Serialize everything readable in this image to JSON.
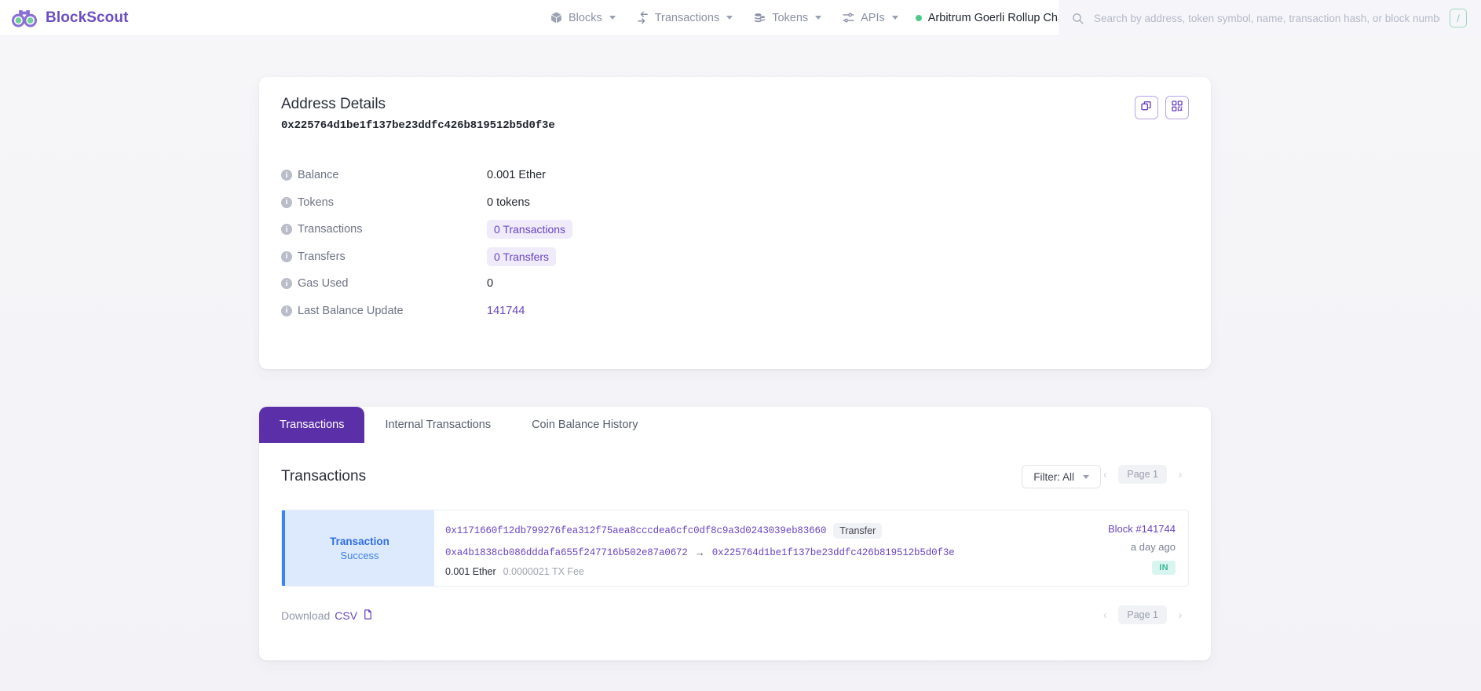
{
  "header": {
    "brand": "BlockScout",
    "nav": [
      {
        "label": "Blocks",
        "icon": "cube-icon"
      },
      {
        "label": "Transactions",
        "icon": "transaction-arrow-icon"
      },
      {
        "label": "Tokens",
        "icon": "coins-stack-icon"
      },
      {
        "label": "APIs",
        "icon": "sliders-icon"
      }
    ],
    "chain": "Arbitrum Goerli Rollup Chain",
    "theme_icon": "moon-icon",
    "search": {
      "placeholder": "Search by address, token symbol, name, transaction hash, or block number",
      "value": "",
      "shortcut": "/"
    }
  },
  "address_card": {
    "title": "Address Details",
    "hash": "0x225764d1be1f137be23ddfc426b819512b5d0f3e",
    "actions": [
      {
        "name": "copy-address-button",
        "icon": "copy-icon"
      },
      {
        "name": "qr-code-button",
        "icon": "qr-code-icon"
      }
    ],
    "rows": [
      {
        "label": "Balance",
        "value": "0.001 Ether",
        "kind": "text"
      },
      {
        "label": "Tokens",
        "value": "0 tokens",
        "kind": "text"
      },
      {
        "label": "Transactions",
        "value": "0 Transactions",
        "kind": "pill"
      },
      {
        "label": "Transfers",
        "value": "0 Transfers",
        "kind": "pill"
      },
      {
        "label": "Gas Used",
        "value": "0",
        "kind": "text"
      },
      {
        "label": "Last Balance Update",
        "value": "141744",
        "kind": "link"
      }
    ]
  },
  "tx_card": {
    "tabs": [
      {
        "label": "Transactions",
        "active": true
      },
      {
        "label": "Internal Transactions",
        "active": false
      },
      {
        "label": "Coin Balance History",
        "active": false
      }
    ],
    "section_title": "Transactions",
    "filter_label": "Filter: All",
    "pagination": {
      "prev": "‹",
      "page": "Page 1",
      "next": "›"
    },
    "transaction": {
      "type": "Transaction",
      "status": "Success",
      "hash": "0x1171660f12db799276fea312f75aea8cccdea6cfc0df8c9a3d0243039eb83660",
      "method_badge": "Transfer",
      "from": "0xa4b1838cb086dddafa655f247716b502e87a0672",
      "arrow": "→",
      "to": "0x225764d1be1f137be23ddfc426b819512b5d0f3e",
      "value": "0.001 Ether",
      "fee": "0.0000021 TX Fee",
      "block": "Block #141744",
      "age": "a day ago",
      "direction": "IN"
    },
    "download": {
      "prefix": "Download",
      "format": "CSV",
      "icon": "file-icon"
    }
  },
  "colors": {
    "brand_purple": "#6b4ec1",
    "tab_active": "#5b2fa8",
    "link": "#6a44c0",
    "success_blue": "#3b82f6",
    "in_badge": "#3bb79c",
    "chain_dot": "#4ec98b"
  }
}
